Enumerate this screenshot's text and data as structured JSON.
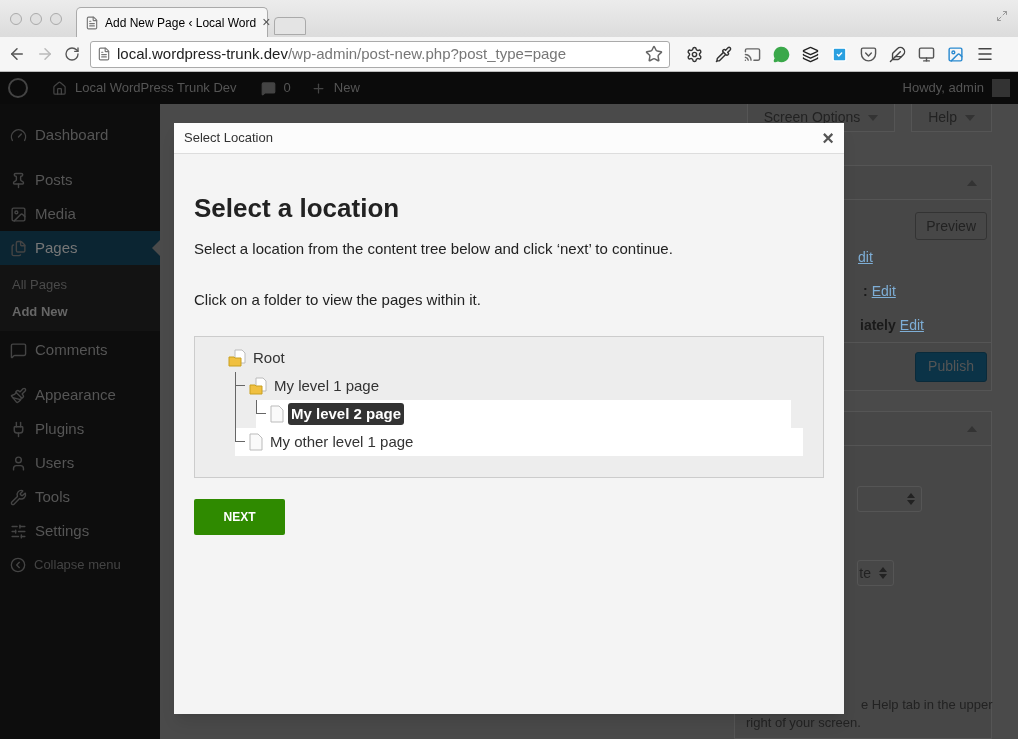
{
  "browser": {
    "tab": {
      "title": "Add New Page ‹ Local Word",
      "close": "×"
    },
    "url": {
      "host": "local.wordpress-trunk.dev",
      "path": "/wp-admin/post-new.php?post_type=page"
    }
  },
  "admin_bar": {
    "site_name": "Local WordPress Trunk Dev",
    "comments_count": "0",
    "new_label": "New",
    "greeting": "Howdy, admin"
  },
  "sidebar": {
    "items": [
      {
        "label": "Dashboard",
        "selected": false
      },
      {
        "label": "Posts",
        "selected": false
      },
      {
        "label": "Media",
        "selected": false
      },
      {
        "label": "Pages",
        "selected": true,
        "children": [
          {
            "label": "All Pages",
            "selected": false
          },
          {
            "label": "Add New",
            "selected": true
          }
        ]
      },
      {
        "label": "Comments",
        "selected": false
      },
      {
        "label": "Appearance",
        "selected": false
      },
      {
        "label": "Plugins",
        "selected": false
      },
      {
        "label": "Users",
        "selected": false
      },
      {
        "label": "Tools",
        "selected": false
      },
      {
        "label": "Settings",
        "selected": false
      }
    ],
    "collapse_label": "Collapse menu"
  },
  "top_buttons": [
    {
      "label": "Screen Options"
    },
    {
      "label": "Help"
    }
  ],
  "publish_box": {
    "preview_label": "Preview",
    "rows": [
      [
        {
          "text": "dit",
          "kind": "link"
        }
      ],
      [
        {
          "text": ":",
          "kind": "bold"
        },
        {
          "text": "Edit",
          "kind": "link"
        }
      ],
      [
        {
          "text": "iately",
          "kind": "bold"
        },
        {
          "text": "Edit",
          "kind": "link"
        }
      ]
    ],
    "publish_label": "Publish"
  },
  "attributes_box": {
    "template_value": "te"
  },
  "help_text": [
    "e Help tab in the upper",
    "right of your screen."
  ],
  "modal": {
    "title": "Select Location",
    "close": "×",
    "heading": "Select a location",
    "paragraphs": [
      "Select a location from the content tree below and click ‘next’ to continue.",
      "Click on a folder to view the pages within it."
    ],
    "tree": {
      "label": "Root",
      "kind": "folder",
      "selected": false,
      "highlighted": false,
      "children": [
        {
          "label": "My level 1 page",
          "kind": "folder",
          "selected": false,
          "highlighted": false,
          "children": [
            {
              "label": "My level 2 page",
              "kind": "page",
              "selected": true,
              "highlighted": true
            }
          ]
        },
        {
          "label": "My other level 1 page",
          "kind": "page",
          "selected": false,
          "highlighted": true
        }
      ]
    },
    "next_label": "NEXT"
  }
}
